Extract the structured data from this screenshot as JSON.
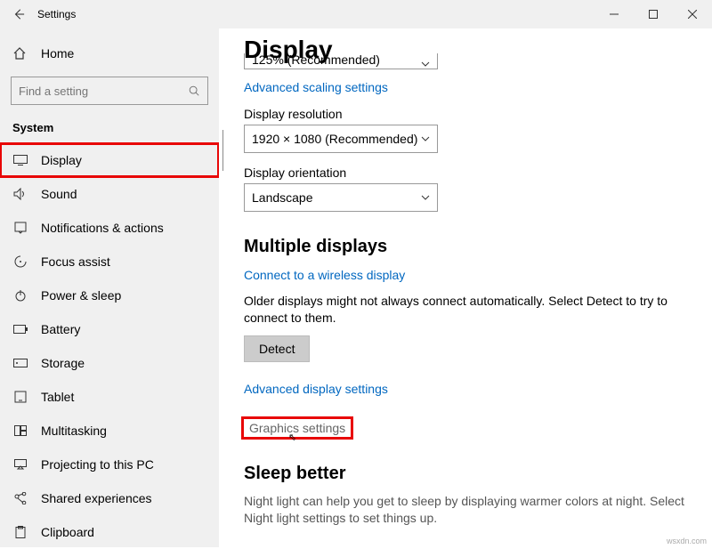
{
  "window": {
    "title": "Settings"
  },
  "sidebar": {
    "home_label": "Home",
    "search_placeholder": "Find a setting",
    "group_header": "System",
    "items": [
      {
        "label": "Display"
      },
      {
        "label": "Sound"
      },
      {
        "label": "Notifications & actions"
      },
      {
        "label": "Focus assist"
      },
      {
        "label": "Power & sleep"
      },
      {
        "label": "Battery"
      },
      {
        "label": "Storage"
      },
      {
        "label": "Tablet"
      },
      {
        "label": "Multitasking"
      },
      {
        "label": "Projecting to this PC"
      },
      {
        "label": "Shared experiences"
      },
      {
        "label": "Clipboard"
      }
    ]
  },
  "main": {
    "page_title": "Display",
    "scale_value": "125% (Recommended)",
    "scaling_link": "Advanced scaling settings",
    "resolution_label": "Display resolution",
    "resolution_value": "1920 × 1080 (Recommended)",
    "orientation_label": "Display orientation",
    "orientation_value": "Landscape",
    "multiple_title": "Multiple displays",
    "wireless_link": "Connect to a wireless display",
    "older_text": "Older displays might not always connect automatically. Select Detect to try to connect to them.",
    "detect_label": "Detect",
    "advanced_display_link": "Advanced display settings",
    "graphics_label": "Graphics settings",
    "sleep_title": "Sleep better",
    "sleep_text": "Night light can help you get to sleep by displaying warmer colors at night. Select Night light settings to set things up."
  },
  "watermark": "wsxdn.com"
}
